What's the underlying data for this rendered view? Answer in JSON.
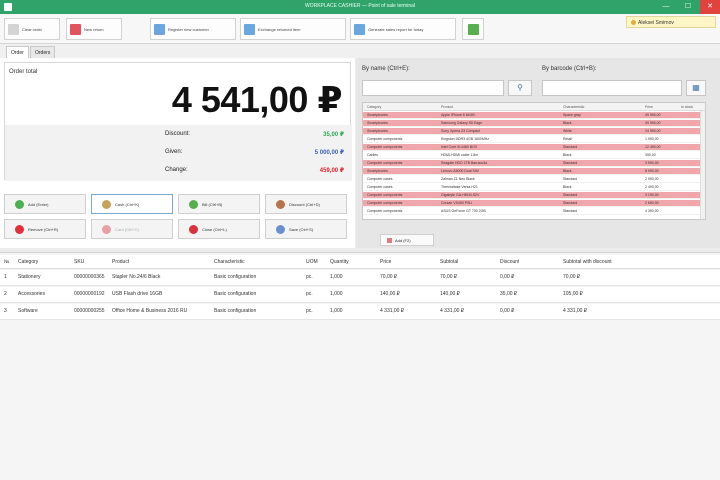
{
  "window": {
    "title": "WORKPLACE CASHIER — Point of sale terminal",
    "minimize": "—",
    "maximize": "☐",
    "close": "✕"
  },
  "toolbar": {
    "buttons": [
      {
        "label": "Clear order",
        "color": "#d4d4d4"
      },
      {
        "label": "New return",
        "color": "#e05560"
      },
      {
        "label": "Register new customer",
        "color": "#6aa6e0"
      },
      {
        "label": "Exchange returned item",
        "color": "#6aa6e0"
      },
      {
        "label": "Generate sales report for today",
        "color": "#6aa6e0"
      },
      {
        "label": "",
        "color": "#56b04f"
      }
    ],
    "user_label": "Aleksei Smirnov"
  },
  "tabs": [
    {
      "label": "Order"
    },
    {
      "label": "Orders"
    }
  ],
  "order": {
    "total_label": "Order total",
    "total_value": "4 541,00 ₽",
    "discount_label": "Discount:",
    "discount_value": "35,00 ₽",
    "given_label": "Given:",
    "given_value": "5 000,00 ₽",
    "change_label": "Change:",
    "change_value": "459,00 ₽",
    "colors": {
      "discount": "#2fa84f",
      "given": "#3a5fb0",
      "change": "#e0202a"
    }
  },
  "actions": [
    {
      "label": "Add (Enter)",
      "color": "#4caf50"
    },
    {
      "label": "Cash (Ctrl+K)",
      "color": "#c8a25a"
    },
    {
      "label": "Bill (Ctrl+B)",
      "color": "#56b04f"
    },
    {
      "label": "Discount (Ctrl+D)",
      "color": "#b8744a"
    },
    {
      "label": "Remove (Ctrl+R)",
      "color": "#e0303a"
    },
    {
      "label": "Card (Ctrl+C)",
      "color": "#e8a0a6"
    },
    {
      "label": "Close (Ctrl+L)",
      "color": "#d8323c"
    },
    {
      "label": "Save (Ctrl+S)",
      "color": "#6a8fd0"
    }
  ],
  "search": {
    "by_name_label": "By name (Ctrl+E):",
    "by_barcode_label": "By barcode (Ctrl+B):"
  },
  "product_grid": {
    "headers": [
      "Category",
      "Product",
      "Characteristic",
      "Price",
      "In stock"
    ],
    "rows": [
      {
        "cells": [
          "Smartphones",
          "Apple iPhone 6 64GB",
          "Space gray",
          "49 990,00",
          ""
        ],
        "red": true
      },
      {
        "cells": [
          "Smartphones",
          "Samsung Galaxy S6 Edge",
          "Black",
          "39 990,00",
          ""
        ],
        "red": true
      },
      {
        "cells": [
          "Smartphones",
          "Sony Xperia Z3 Compact",
          "White",
          "24 990,00",
          ""
        ],
        "red": true
      },
      {
        "cells": [
          "Computer components",
          "Kingston DDR3 4GB 1600MHz",
          "Retail",
          "1 990,00",
          ""
        ],
        "red": false
      },
      {
        "cells": [
          "Computer components",
          "Intel Core i5-4460 BOX",
          "Standard",
          "12 490,00",
          ""
        ],
        "red": true
      },
      {
        "cells": [
          "Cables",
          "HDMI-HDMI cable 1.8m",
          "Black",
          "390,00",
          ""
        ],
        "red": false
      },
      {
        "cells": [
          "Computer components",
          "Seagate HDD 1TB Barracuda",
          "Standard",
          "3 590,00",
          ""
        ],
        "red": true
      },
      {
        "cells": [
          "Smartphones",
          "Lenovo A6000 Dual SIM",
          "Black",
          "8 990,00",
          ""
        ],
        "red": true
      },
      {
        "cells": [
          "Computer cases",
          "Zalman Z1 Neo Black",
          "Standard",
          "2 990,00",
          ""
        ],
        "red": false
      },
      {
        "cells": [
          "Computer cases",
          "Thermaltake Versa H21",
          "Black",
          "2 490,00",
          ""
        ],
        "red": false
      },
      {
        "cells": [
          "Computer components",
          "Gigabyte GA-H81M-S2V",
          "Standard",
          "3 190,00",
          ""
        ],
        "red": true
      },
      {
        "cells": [
          "Computer components",
          "Corsair VS450 PSU",
          "Standard",
          "2 690,00",
          ""
        ],
        "red": true
      },
      {
        "cells": [
          "Computer components",
          "ASUS GeForce GT 730 2GB",
          "Standard",
          "4 390,00",
          ""
        ],
        "red": false
      }
    ],
    "add_button_label": "Add (F2)"
  },
  "order_table": {
    "headers": [
      "№",
      "Category",
      "SKU",
      "Product",
      "Characteristic",
      "UOM",
      "Quantity",
      "Price",
      "Subtotal",
      "Discount",
      "Subtotal with discount"
    ],
    "rows": [
      [
        "1",
        "Stationery",
        "00000000365",
        "Stapler No.24/6 Black",
        "Basic configuration",
        "pc.",
        "1,000",
        "70,00 ₽",
        "70,00 ₽",
        "0,00 ₽",
        "70,00 ₽"
      ],
      [
        "2",
        "Accessories",
        "00000000192",
        "USB Flash drive 16GB",
        "Basic configuration",
        "pc.",
        "1,000",
        "140,00 ₽",
        "140,00 ₽",
        "35,00 ₽",
        "105,00 ₽"
      ],
      [
        "3",
        "Software",
        "00000000255",
        "Office Home & Business 2016 RU",
        "Basic configuration",
        "pc.",
        "1,000",
        "4 331,00 ₽",
        "4 331,00 ₽",
        "0,00 ₽",
        "4 331,00 ₽"
      ]
    ]
  }
}
